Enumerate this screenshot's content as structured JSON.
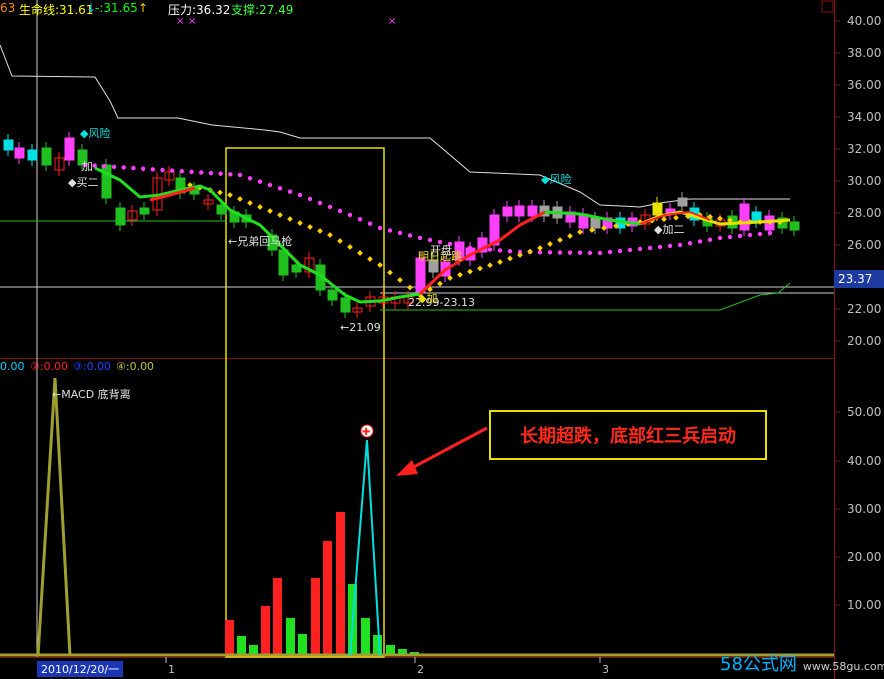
{
  "header": {
    "prefix": "63",
    "lifeline_label": "生命线:31.61",
    "arrow1": "↓",
    "mid_label": "-:31.65",
    "arrow2": "↑",
    "pressure_label": "压力:36.32",
    "support_label": "支撑:27.49"
  },
  "sub_header": {
    "v1": "0.00",
    "v2": "②:0.00",
    "v3": "③:0.00",
    "v4": "④:0.00"
  },
  "price_axis": [
    "40.00",
    "38.00",
    "36.00",
    "34.00",
    "32.00",
    "30.00",
    "28.00",
    "26.00",
    "22.00",
    "20.00"
  ],
  "current_price": "23.37",
  "macd_axis": [
    "50.00",
    "40.00",
    "30.00",
    "20.00",
    "10.00"
  ],
  "annotations": {
    "risk1": "◆风险",
    "risk2": "◆风险",
    "jia1": "加",
    "mai": "◆买二",
    "jia2": "◆加二",
    "brother": "←兄弟回马枪",
    "low_value": "←21.09",
    "range": "22.99-23.13",
    "tomorrow": "明日起跳",
    "open": "开盘",
    "jiagai": "◆加",
    "macd_divergence": "←MACD 底背离"
  },
  "callout_text": "长期超跌，底部红三兵启动",
  "time_axis": {
    "date": "2010/12/20/一",
    "t1": "1",
    "t2": "2",
    "t3": "3"
  },
  "logo": {
    "brand": "58公式网",
    "url": "www.58gu.com"
  },
  "colors": {
    "up": "#ff2020",
    "down": "#20c020",
    "pink": "#ff40ff",
    "yellow": "#e8e100",
    "cyan": "#00e0e0",
    "olive": "#a0a030",
    "axis_red": "#8a1010"
  }
}
